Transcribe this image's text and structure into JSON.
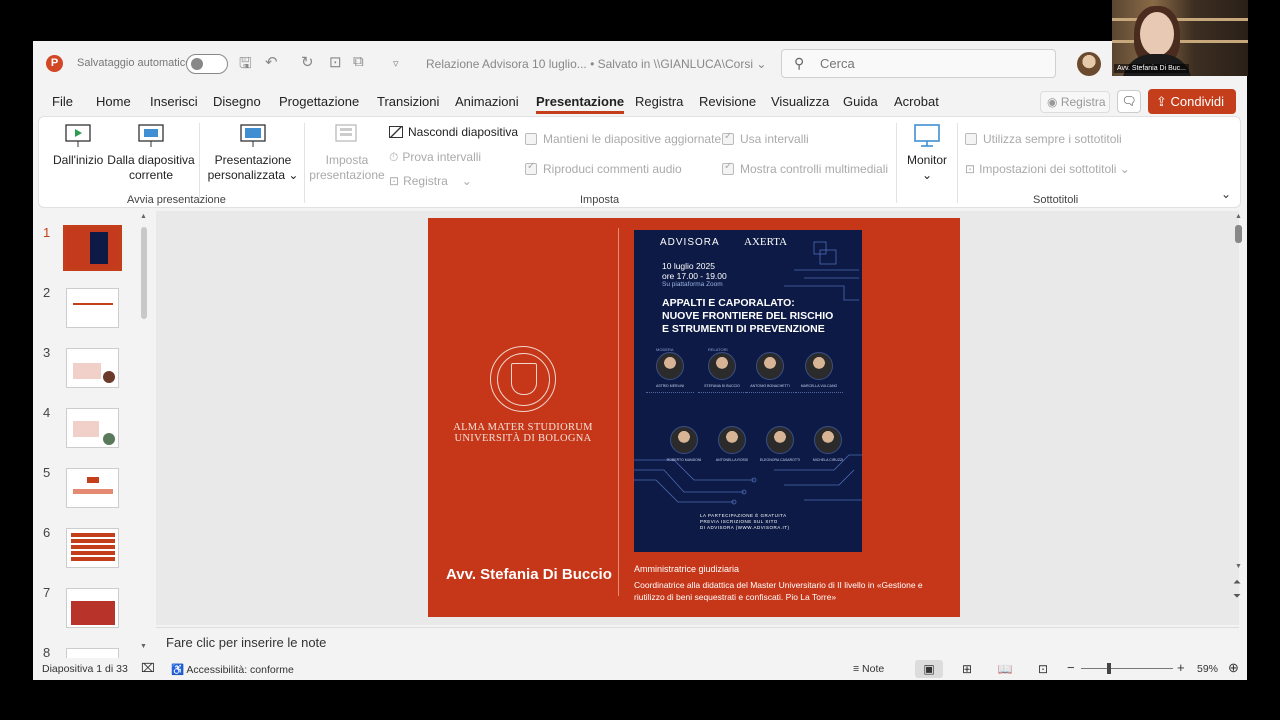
{
  "titlebar": {
    "autosave_label": "Salvataggio automatico",
    "doc_title": "Relazione Advisora 10 luglio...  •  Salvato in \\\\GIANLUCA\\Corsi ⌄",
    "search_placeholder": "Cerca"
  },
  "menu": {
    "tabs": [
      "File",
      "Home",
      "Inserisci",
      "Disegno",
      "Progettazione",
      "Transizioni",
      "Animazioni",
      "Presentazione",
      "Registra",
      "Revisione",
      "Visualizza",
      "Guida",
      "Acrobat"
    ],
    "active_tab": "Presentazione",
    "registra_button": "Registra",
    "share_button": "Condividi ⌄"
  },
  "ribbon": {
    "from_start": "Dall'inizio",
    "from_current_1": "Dalla diapositiva",
    "from_current_2": "corrente",
    "custom_1": "Presentazione",
    "custom_2": "personalizzata ⌄",
    "group_start": "Avvia presentazione",
    "setup_1": "Imposta",
    "setup_2": "presentazione",
    "hide_slide": "Nascondi diapositiva",
    "rehearse": "Prova intervalli",
    "record": "Registra",
    "keep_updated": "Mantieni le diapositive aggiornate",
    "play_narrations": "Riproduci commenti audio",
    "use_timings": "Usa intervalli",
    "show_media_controls": "Mostra controlli multimediali",
    "group_setup": "Imposta",
    "monitor": "Monitor",
    "always_subtitles": "Utilizza sempre i sottotitoli",
    "subtitle_settings": "Impostazioni dei sottotitoli ⌄",
    "group_subtitles": "Sottotitoli"
  },
  "thumbnails": {
    "numbers": [
      "1",
      "2",
      "3",
      "4",
      "5",
      "6",
      "7",
      "8"
    ],
    "selected": "1"
  },
  "slide": {
    "university_line1": "ALMA MATER STUDIORUM",
    "university_line2": "UNIVERSITÀ DI BOLOGNA",
    "speaker_name": "Avv. Stefania Di Buccio",
    "role": "Amministratrice giudiziaria",
    "description": "Coordinatrice alla didattica del Master Universitario di II livello in «Gestione e riutilizzo di beni sequestrati e confiscati. Pio La Torre»",
    "poster": {
      "brand1": "ADVISORA",
      "brand2": "AXERTA",
      "date_line1": "10 luglio 2025",
      "date_line2": "ore 17.00 - 19.00",
      "platform": "Su piattaforma Zoom",
      "title_line1": "APPALTI E CAPORALATO:",
      "title_line2": "NUOVE FRONTIERE DEL RISCHIO",
      "title_line3": "E STRUMENTI DI PREVENZIONE",
      "label_modera": "MODERA",
      "label_relatori": "RELATORI",
      "speakers_row1": [
        "ASTRID MERLINI",
        "STEFANIA DI BUCCIO",
        "ANTONIO BONACHETTI",
        "MARCELLA VULCANO"
      ],
      "speakers_row2": [
        "ROBERTO MANDONI",
        "ANTONELLA ROSSI",
        "ELEONORA CASAROTTI",
        "MICHELA CIRUZZI"
      ],
      "note_line1": "LA PARTECIPAZIONE È GRATUITA",
      "note_line2": "PREVIA ISCRIZIONE SUL SITO",
      "note_line3": "DI ADVISORA (WWW.ADVISORA.IT)"
    }
  },
  "notes": {
    "placeholder": "Fare clic per inserire le note"
  },
  "statusbar": {
    "slide_counter": "Diapositiva 1 di 33",
    "accessibility": "Accessibilità: conforme",
    "notes_button": "Note",
    "zoom_level": "59%",
    "zoom_fraction": 0.3
  },
  "video": {
    "participant_name": "Avv. Stefania Di Buc..."
  },
  "colors": {
    "accent": "#c43e1c",
    "slide_bg": "#c63719",
    "poster_bg": "#0c1a45"
  }
}
